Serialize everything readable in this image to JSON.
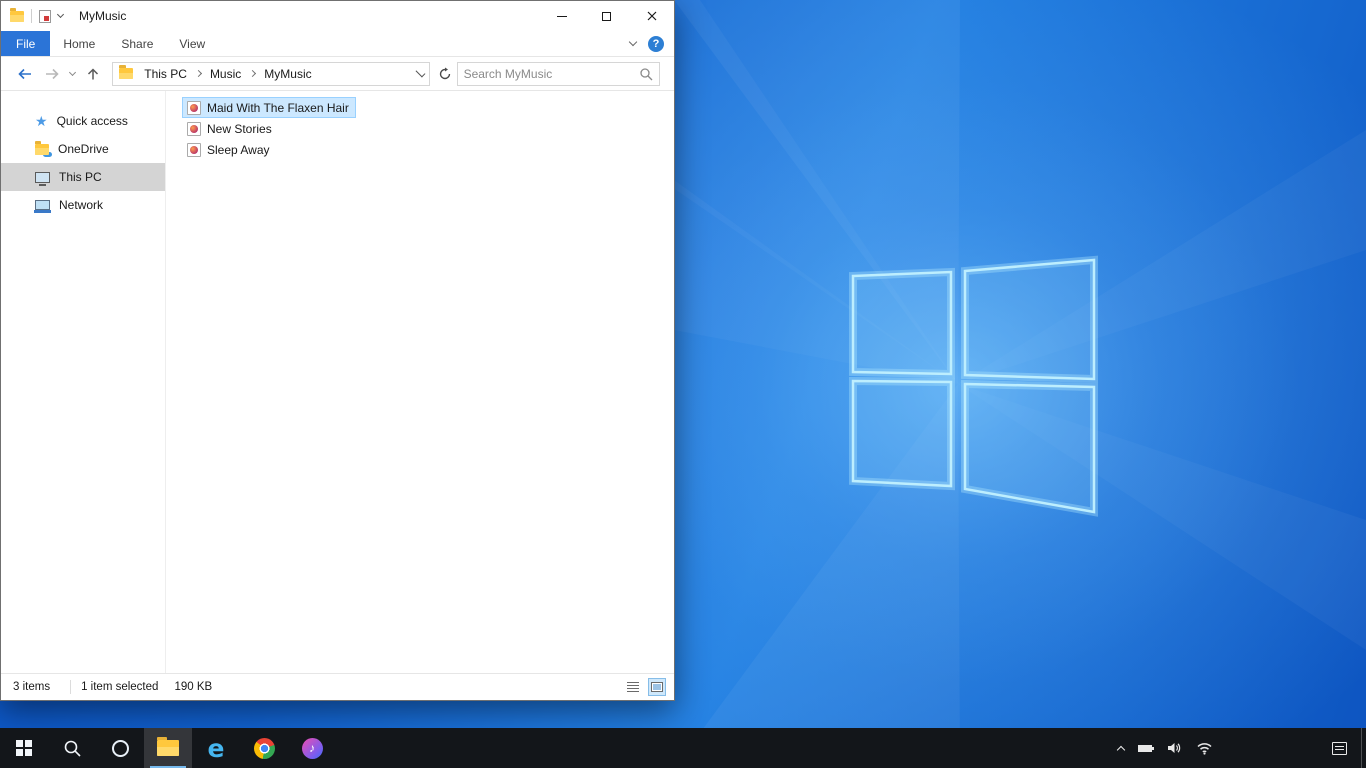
{
  "window": {
    "title": "MyMusic",
    "help_glyph": "?",
    "tabs": [
      {
        "label": "File",
        "active": true
      },
      {
        "label": "Home",
        "active": false
      },
      {
        "label": "Share",
        "active": false
      },
      {
        "label": "View",
        "active": false
      }
    ],
    "breadcrumb": {
      "items": [
        "This PC",
        "Music",
        "MyMusic"
      ]
    },
    "search": {
      "placeholder": "Search MyMusic"
    },
    "sidebar": {
      "items": [
        {
          "label": "Quick access",
          "icon": "star-icon",
          "selected": false
        },
        {
          "label": "OneDrive",
          "icon": "onedrive-folder-icon",
          "selected": false
        },
        {
          "label": "This PC",
          "icon": "computer-icon",
          "selected": true
        },
        {
          "label": "Network",
          "icon": "network-icon",
          "selected": false
        }
      ]
    },
    "files": {
      "items": [
        {
          "name": "Maid With The Flaxen Hair",
          "icon": "music-file-icon",
          "selected": true
        },
        {
          "name": "New Stories",
          "icon": "music-file-icon",
          "selected": false
        },
        {
          "name": "Sleep Away",
          "icon": "music-file-icon",
          "selected": false
        }
      ]
    },
    "status": {
      "count": "3 items",
      "selection": "1 item selected",
      "size": "190 KB",
      "view_buttons": [
        "details-view",
        "large-icons-view"
      ]
    },
    "titlebar_icons": [
      "folder-icon",
      "properties-icon",
      "customize-chevron-icon"
    ],
    "nav_buttons": [
      "back",
      "forward",
      "recent-locations",
      "up"
    ]
  },
  "taskbar": {
    "buttons": [
      {
        "name": "start",
        "active": false
      },
      {
        "name": "search",
        "active": false
      },
      {
        "name": "cortana",
        "active": false
      },
      {
        "name": "file-explorer",
        "active": true
      },
      {
        "name": "internet-explorer",
        "active": false
      },
      {
        "name": "chrome",
        "active": false
      },
      {
        "name": "itunes",
        "active": false
      }
    ],
    "glyphs": {
      "internet_explorer": "e",
      "itunes_note": "♪"
    },
    "tray": [
      "hidden-icons-chevron",
      "battery",
      "volume",
      "wifi",
      "action-center"
    ]
  },
  "desktop": {
    "wallpaper": "windows-10-light-rays"
  },
  "colors": {
    "accent_blue": "#2b74d7",
    "selection_fill": "#cce8ff",
    "selection_border": "#99d1ff",
    "sidebar_selected": "#d4d4d4",
    "taskbar_bg": "#13161a",
    "help_badge": "#2d7fd4"
  }
}
